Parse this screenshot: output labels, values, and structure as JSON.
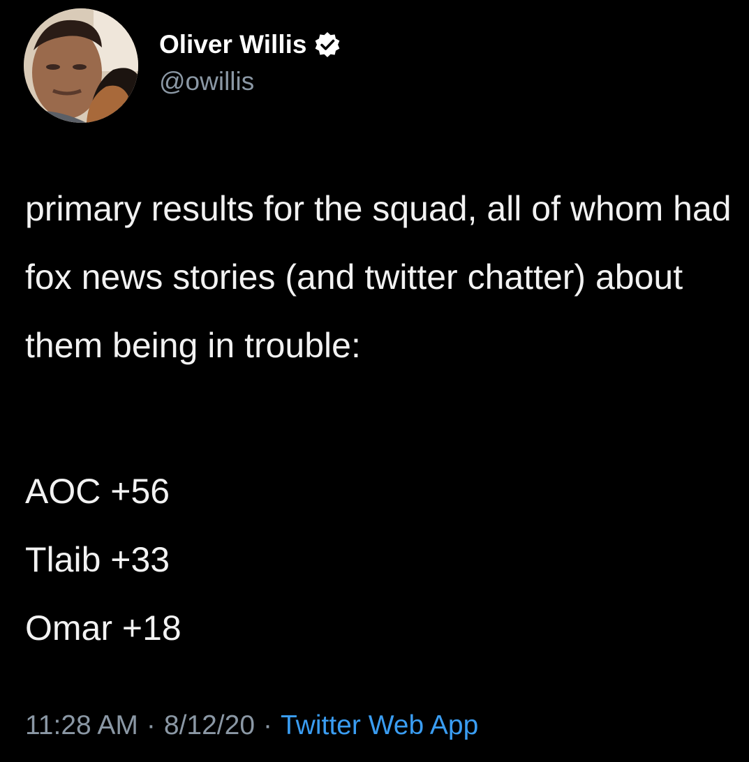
{
  "author": {
    "display_name": "Oliver Willis",
    "handle": "@owillis",
    "verified": true,
    "avatar_icon": "profile-photo"
  },
  "tweet": {
    "text": "primary results for the squad, all of whom had fox news stories (and twitter chatter) about them being in trouble:",
    "results": [
      "AOC +56",
      "Tlaib +33",
      "Omar +18"
    ]
  },
  "meta": {
    "time": "11:28 AM",
    "separator": "·",
    "date": "8/12/20",
    "source": "Twitter Web App"
  },
  "colors": {
    "background": "#000000",
    "text": "#f2f2f2",
    "muted": "#8b98a5",
    "link": "#3a9df2"
  }
}
